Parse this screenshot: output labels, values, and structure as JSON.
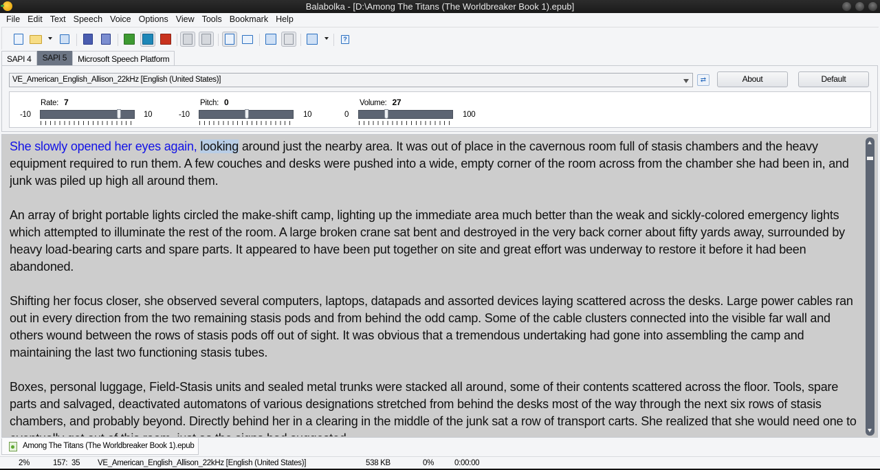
{
  "window": {
    "title": "Balabolka - [D:\\Among The Titans (The Worldbreaker Book 1).epub]"
  },
  "menu": [
    "File",
    "Edit",
    "Text",
    "Speech",
    "Voice",
    "Options",
    "View",
    "Tools",
    "Bookmark",
    "Help"
  ],
  "toolbar": {
    "buttons": [
      {
        "name": "new-document",
        "icon": "new-document-icon"
      },
      {
        "name": "open-file",
        "icon": "folder-icon"
      },
      {
        "name": "open-file-dropdown",
        "icon": "chevron-down-icon"
      },
      {
        "name": "save",
        "icon": "floppy-disk-icon"
      },
      {
        "name": "save-audio",
        "icon": "save-audio-icon"
      },
      {
        "name": "save-audio-split",
        "icon": "save-audio-split-icon"
      },
      {
        "name": "read-aloud",
        "icon": "play-icon"
      },
      {
        "name": "pause",
        "icon": "pause-icon"
      },
      {
        "name": "stop",
        "icon": "stop-icon"
      },
      {
        "name": "read-clipboard",
        "icon": "clipboard-read-icon"
      },
      {
        "name": "read-clipboard-alt",
        "icon": "clipboard-read-alt-icon"
      },
      {
        "name": "spelling",
        "icon": "document-edit-icon"
      },
      {
        "name": "pronunciation",
        "icon": "book-ab-icon"
      },
      {
        "name": "add-bookmark",
        "icon": "add-bookmark-icon"
      },
      {
        "name": "go-bookmark",
        "icon": "bookmark-goto-icon"
      },
      {
        "name": "bookmark-menu",
        "icon": "bookmark-list-icon"
      },
      {
        "name": "bookmark-menu-dropdown",
        "icon": "chevron-down-icon"
      },
      {
        "name": "help",
        "icon": "help-icon"
      }
    ]
  },
  "engine_tabs": [
    {
      "label": "SAPI 4",
      "active": false
    },
    {
      "label": "SAPI 5",
      "active": true
    },
    {
      "label": "Microsoft Speech Platform",
      "active": false
    }
  ],
  "voice": {
    "selected": "VE_American_English_Allison_22kHz [English (United States)]",
    "about_label": "About",
    "default_label": "Default"
  },
  "sliders": {
    "rate": {
      "label": "Rate:",
      "value": 7,
      "min": -10,
      "max": 10
    },
    "pitch": {
      "label": "Pitch:",
      "value": 0,
      "min": -10,
      "max": 10
    },
    "volume": {
      "label": "Volume:",
      "value": 27,
      "min": 0,
      "max": 100
    }
  },
  "text": {
    "spoken": "She slowly opened her eyes again,",
    "current_word": "looking",
    "para1_rest": " around just the nearby area. It was out of place in the cavernous room full of stasis chambers and the heavy equipment required to run them. A few couches and desks were pushed into a wide, empty corner of the room across from the chamber she had been in, and junk was piled up high all around them.",
    "para2": "An array of bright portable lights circled the make-shift camp, lighting up the immediate area much better than the weak and sickly-colored emergency lights which attempted to illuminate the rest of the room. A large broken crane sat bent and destroyed in the very back corner about fifty yards away, surrounded by heavy load-bearing carts and spare parts. It appeared to have been put together on site and great effort was underway to restore it before it had been abandoned.",
    "para3": "Shifting her focus closer, she observed several computers, laptops, datapads and assorted devices laying scattered across the desks. Large power cables ran out in every direction from the two remaining stasis pods and from behind the odd camp. Some of the cable clusters connected into the visible far wall and others wound between the rows of stasis pods off out of sight. It was obvious that a tremendous undertaking had gone into assembling the camp and maintaining the last two functioning stasis tubes.",
    "para4": "Boxes, personal luggage, Field-Stasis units and sealed metal trunks were stacked all around, some of their contents scattered across the floor. Tools, spare parts and salvaged, deactivated automatons of various designations stretched from behind the desks most of the way through the next six rows of stasis chambers, and probably beyond. Directly behind her in a clearing in the middle of the junk sat a row of transport carts. She realized that she would need one to eventually get out of this room, just as the signs had suggested."
  },
  "document_tab": {
    "label": "Among The Titans (The Worldbreaker Book 1).epub"
  },
  "status": {
    "progress": "2%",
    "position": "157:  35",
    "voice": "VE_American_English_Allison_22kHz [English (United States)]",
    "size": "538 KB",
    "audio_progress": "0%",
    "elapsed": "0:00:00",
    "remaining": "0:00:00"
  },
  "colors": {
    "spoken_text": "#1212e6",
    "current_word_bg": "#b8cde6",
    "text_bg": "#cdcdcd",
    "slider_track": "#5d6573",
    "active_tab": "#6c7584"
  }
}
